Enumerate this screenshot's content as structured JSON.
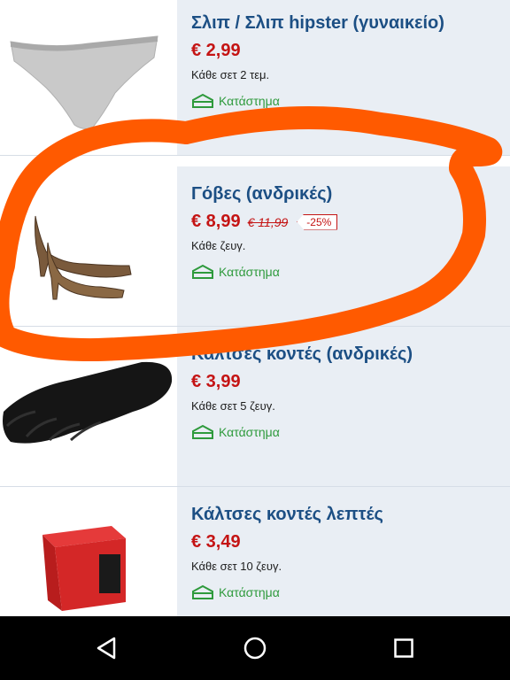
{
  "products": [
    {
      "title": "Σλιπ / Σλιπ hipster (γυναικείο)",
      "price": "€ 2,99",
      "unit": "Κάθε σετ 2 τεμ.",
      "store_label": "Κατάστημα",
      "image": "grey-underwear"
    },
    {
      "title": "Γόβες (ανδρικές)",
      "price": "€ 8,99",
      "old_price": "€ 11,99",
      "discount": "-25%",
      "unit": "Κάθε ζευγ.",
      "store_label": "Κατάστημα",
      "image": "brown-high-heel-shoes"
    },
    {
      "title": "Κάλτσες κοντές (ανδρικές)",
      "price": "€ 3,99",
      "unit": "Κάθε σετ 5 ζευγ.",
      "store_label": "Κατάστημα",
      "image": "black-socks"
    },
    {
      "title": "Κάλτσες κοντές λεπτές",
      "price": "€ 3,49",
      "unit": "Κάθε σετ 10 ζευγ.",
      "store_label": "Κατάστημα",
      "image": "red-sock-box"
    }
  ],
  "colors": {
    "title": "#1c4f84",
    "price": "#c41414",
    "store": "#2e9a3c",
    "info_bg": "#e9eef4",
    "annotation": "#ff5a00"
  },
  "navbar": {
    "icons": [
      "back-icon",
      "home-icon",
      "recents-icon"
    ]
  }
}
